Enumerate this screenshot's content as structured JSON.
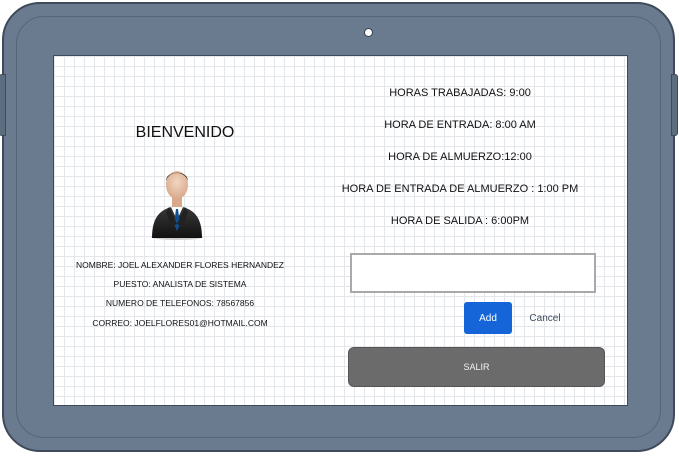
{
  "welcome": {
    "title": "BIENVENIDO"
  },
  "profile": {
    "nombre": "NOMBRE: JOEL ALEXANDER FLORES HERNANDEZ",
    "puesto": "PUESTO: ANALISTA DE SISTEMA",
    "telefono": "NUMERO DE TELEFONOS: 78567856",
    "correo": "CORREO: JOELFLORES01@HOTMAIL.COM"
  },
  "schedule": {
    "horas_trabajadas": "HORAS TRABAJADAS: 9:00",
    "hora_entrada": "HORA DE ENTRADA: 8:00 AM",
    "hora_almuerzo": "HORA DE ALMUERZO:12:00",
    "hora_entrada_almuerzo": "HORA DE ENTRADA DE ALMUERZO : 1:00 PM",
    "hora_salida": "HORA DE SALIDA : 6:00PM"
  },
  "form": {
    "input_value": "",
    "add_label": "Add",
    "cancel_label": "Cancel"
  },
  "actions": {
    "salir_label": "SALIR"
  },
  "colors": {
    "device_frame": "#6a7b90",
    "accent_button": "#1565d8",
    "salir_button": "#6b6b6b"
  },
  "icons": {
    "avatar": "user-avatar-icon",
    "camera": "camera-icon"
  }
}
